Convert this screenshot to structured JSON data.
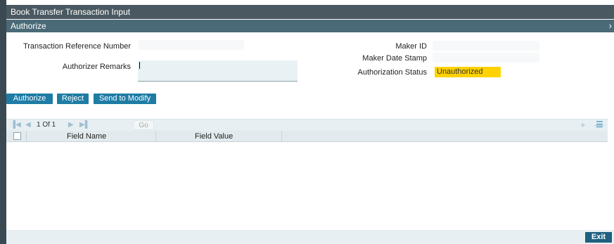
{
  "window": {
    "title": "Book Transfer Transaction Input",
    "close_glyph": "✕"
  },
  "panel": {
    "title": "Authorize",
    "close_glyph": "›"
  },
  "form": {
    "txn_ref_label": "Transaction Reference Number",
    "txn_ref_value": "",
    "authorizer_remarks_label": "Authorizer Remarks",
    "authorizer_remarks_value": "",
    "maker_id_label": "Maker ID",
    "maker_id_value": "",
    "maker_date_label": "Maker Date Stamp",
    "maker_date_value": "",
    "auth_status_label": "Authorization Status",
    "auth_status_value": "Unauthorized"
  },
  "actions": {
    "authorize": "Authorize",
    "reject": "Reject",
    "send_to_modify": "Send to Modify"
  },
  "grid": {
    "pager_text": "1 Of 1",
    "go_label": "Go",
    "columns": [
      "Field Name",
      "Field Value"
    ],
    "rows": []
  },
  "footer": {
    "exit": "Exit"
  },
  "colors": {
    "accent": "#1e7ca5",
    "status_highlight": "#ffd200",
    "titlebar": "#4a5961",
    "subbar": "#4a6a77"
  }
}
